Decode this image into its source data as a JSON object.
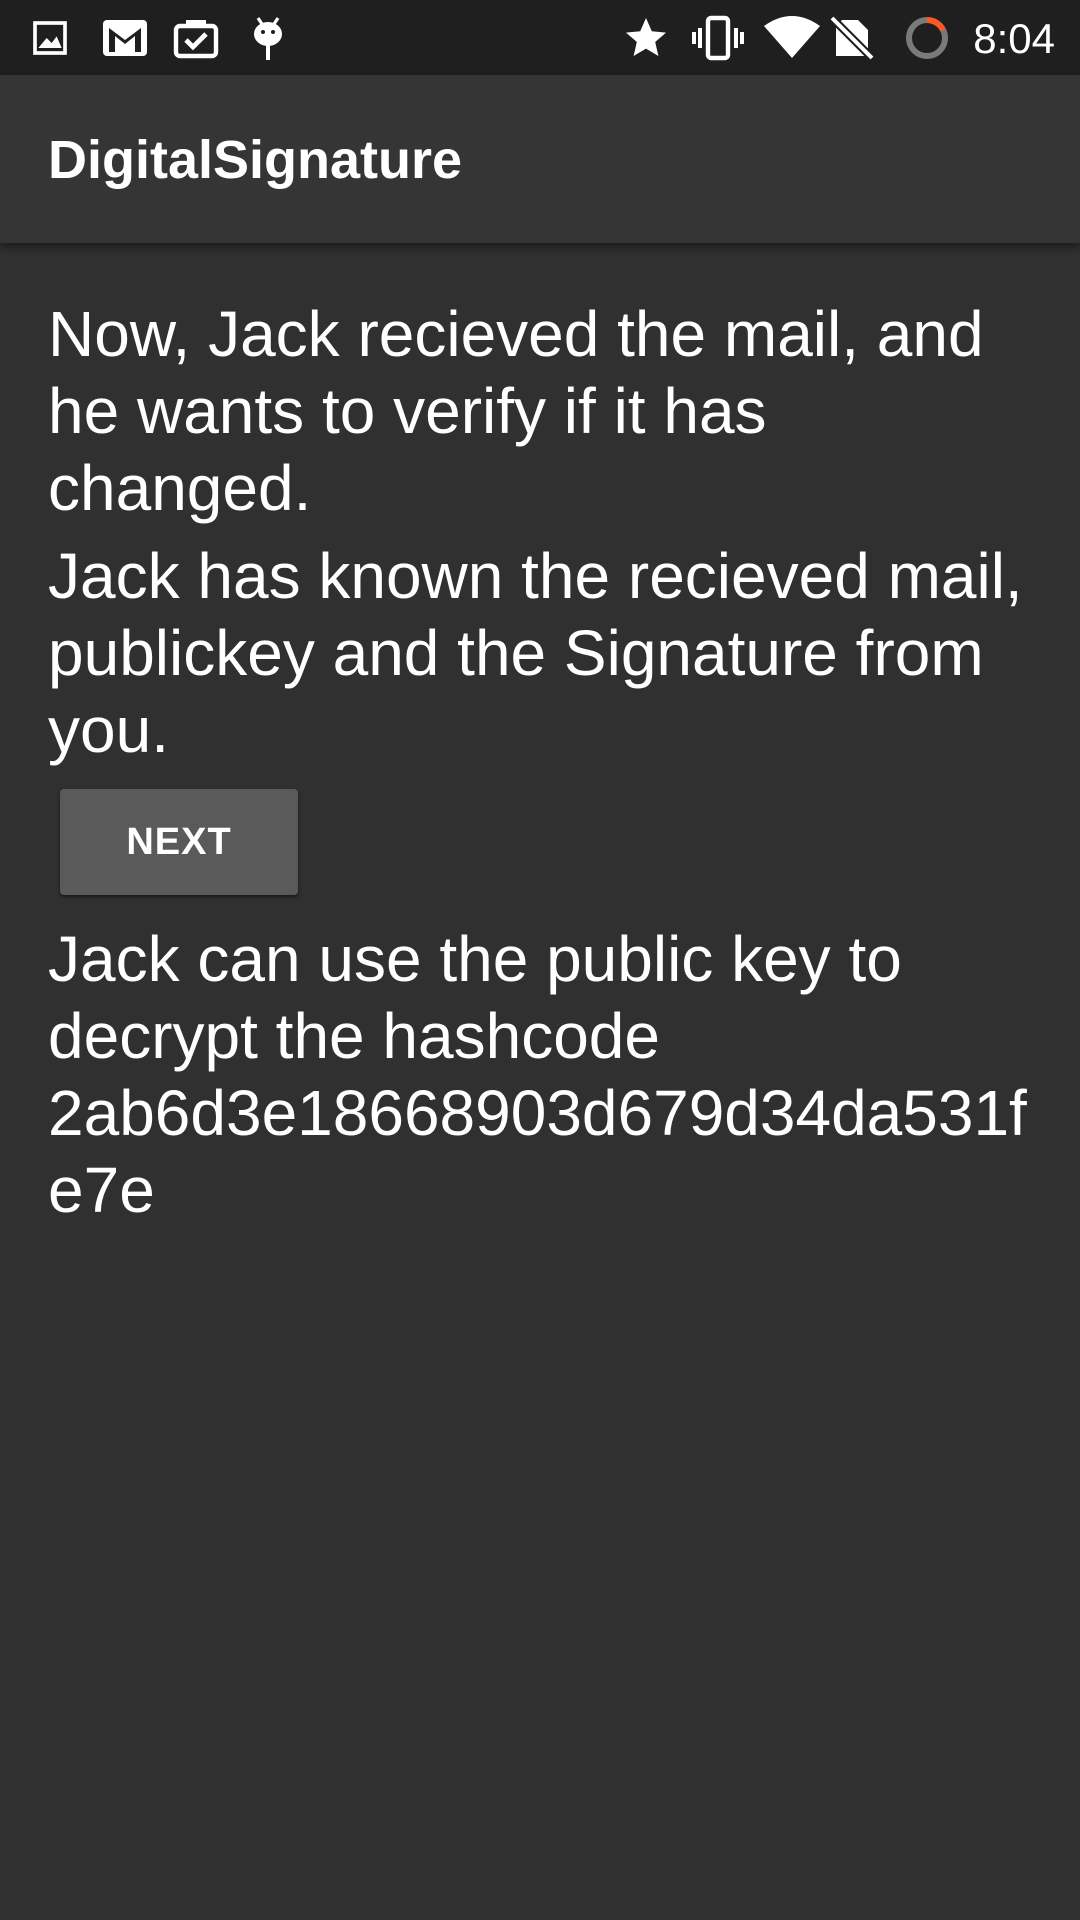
{
  "status_bar": {
    "time": "8:04",
    "left_icons": [
      "image-icon",
      "gmail-icon",
      "briefcase-check-icon",
      "android-debug-icon"
    ],
    "right_icons": [
      "star-icon",
      "vibrate-icon",
      "wifi-icon",
      "no-sim-icon",
      "sync-progress-icon"
    ],
    "progress_accent": "#ff5722"
  },
  "app_bar": {
    "title": "DigitalSignature"
  },
  "main": {
    "paragraph_1": "Now, Jack recieved the mail, and he wants to verify if it has changed.",
    "paragraph_2": "Jack has known the recieved mail, publickey and the Signature from you.",
    "next_button": "NEXT",
    "paragraph_3": "Jack can use the public key to decrypt the hashcode 2ab6d3e18668903d679d34da531fe7e"
  },
  "colors": {
    "background": "#303030",
    "status_bar": "#1f1f1f",
    "app_bar": "#353535",
    "button": "#5a5a5b",
    "text": "#ffffff"
  }
}
